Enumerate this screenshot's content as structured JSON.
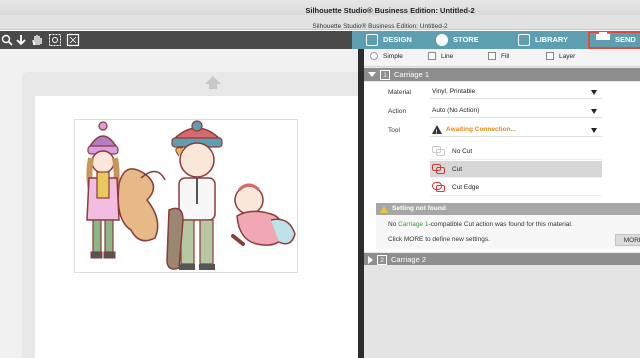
{
  "window": {
    "title": "Silhouette Studio® Business Edition: Untitled-2",
    "doc_title": "Silhouette Studio® Business Edition: Untitled-2"
  },
  "toolbar": {
    "icons": [
      "zoom-in-icon",
      "move-down-icon",
      "pan-hand-icon",
      "select-image-icon"
    ]
  },
  "nav": {
    "tabs": [
      {
        "label": "DESIGN",
        "icon": "grid-icon"
      },
      {
        "label": "STORE",
        "icon": "store-icon"
      },
      {
        "label": "LIBRARY",
        "icon": "library-icon"
      },
      {
        "label": "SEND",
        "icon": "send-icon"
      }
    ],
    "active": "SEND",
    "highlight_color": "#e04a3a",
    "bar_color": "#5d9fb1"
  },
  "modes": [
    {
      "label": "Simple",
      "icon": "radio"
    },
    {
      "label": "Line",
      "icon": "line-mode-icon"
    },
    {
      "label": "Fill",
      "icon": "fill-mode-icon"
    },
    {
      "label": "Layer",
      "icon": "layer-mode-icon"
    }
  ],
  "carriage1": {
    "number": "1",
    "label": "Carriage 1",
    "material_label": "Material",
    "material_value": "Vinyl, Printable",
    "action_label": "Action",
    "action_value": "Auto (No Action)",
    "tool_label": "Tool",
    "tool_value": "Awaiting Connection...",
    "tool_options": [
      {
        "label": "No Cut",
        "icon": "no-cut-icon",
        "selected": false
      },
      {
        "label": "Cut",
        "icon": "cut-icon",
        "selected": true
      },
      {
        "label": "Cut Edge",
        "icon": "cut-edge-icon",
        "selected": false
      }
    ]
  },
  "notice": {
    "title": "Setting not found",
    "line1_pre": "No ",
    "line1_link": "Carriage 1",
    "line1_post": "-compatible Cut action was found for this material.",
    "line2": "Click MORE to define new settings.",
    "more_button": "MORE"
  },
  "carriage2": {
    "number": "2",
    "label": "Carriage 2"
  }
}
